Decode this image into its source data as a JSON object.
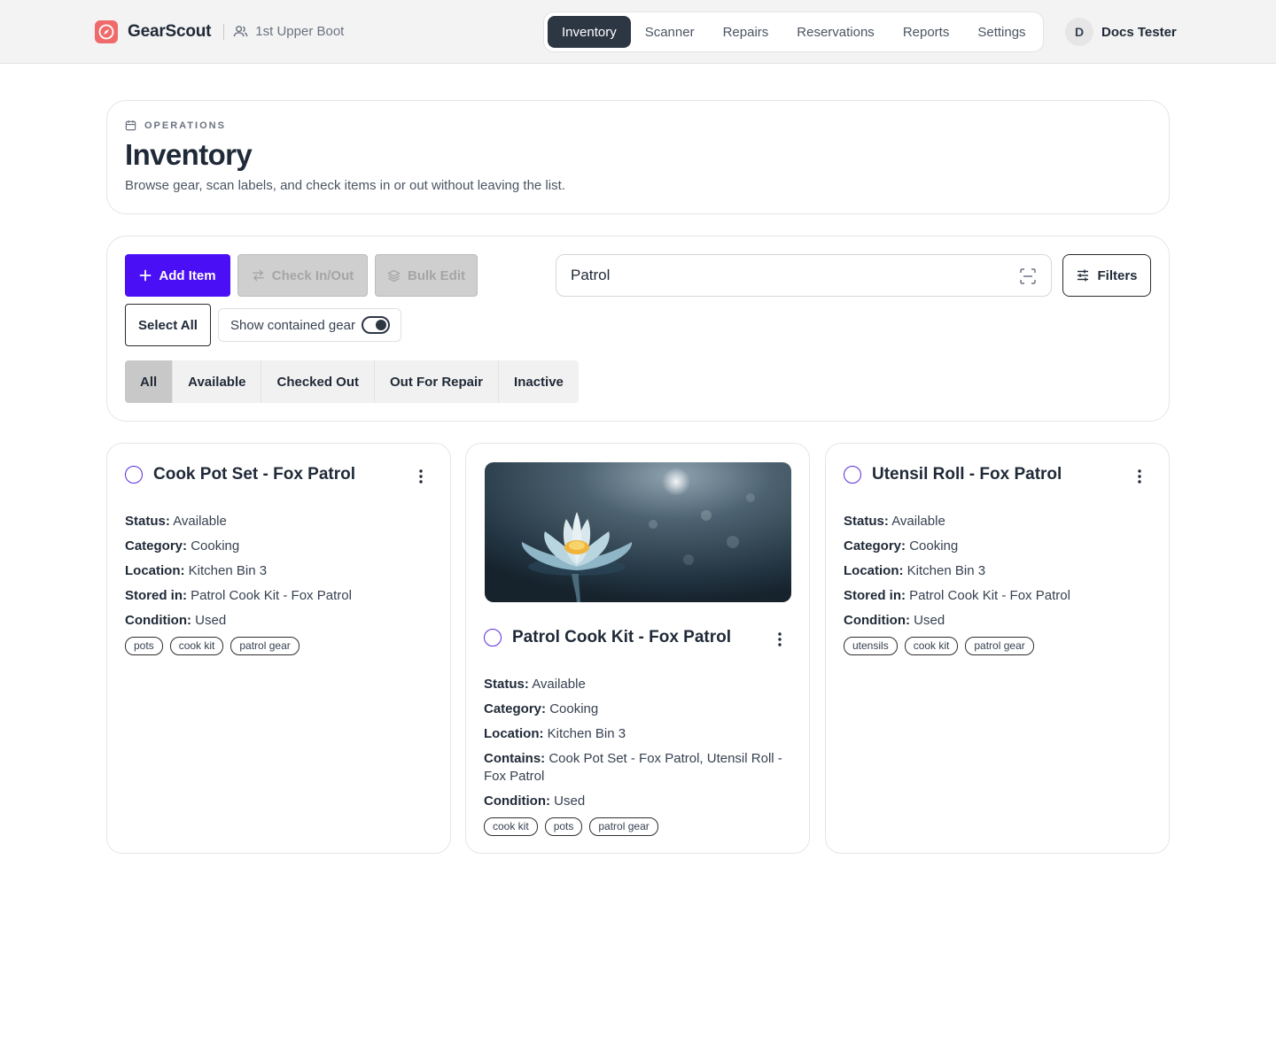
{
  "brand": {
    "name": "GearScout",
    "unit": "1st Upper Boot"
  },
  "nav": {
    "items": [
      {
        "label": "Inventory",
        "active": true
      },
      {
        "label": "Scanner"
      },
      {
        "label": "Repairs"
      },
      {
        "label": "Reservations"
      },
      {
        "label": "Reports"
      },
      {
        "label": "Settings"
      }
    ]
  },
  "user": {
    "initial": "D",
    "name": "Docs Tester"
  },
  "header": {
    "eyebrow": "OPERATIONS",
    "title": "Inventory",
    "subtitle": "Browse gear, scan labels, and check items in or out without leaving the list."
  },
  "toolbar": {
    "add_label": "Add Item",
    "check_label": "Check In/Out",
    "bulk_label": "Bulk Edit",
    "select_all_label": "Select All",
    "toggle_label": "Show contained gear",
    "toggle_on": true,
    "search_value": "Patrol",
    "filters_label": "Filters"
  },
  "status_tabs": [
    {
      "label": "All",
      "active": true
    },
    {
      "label": "Available"
    },
    {
      "label": "Checked Out"
    },
    {
      "label": "Out For Repair"
    },
    {
      "label": "Inactive"
    }
  ],
  "items": [
    {
      "title": "Cook Pot Set - Fox Patrol",
      "status": "Available",
      "category": "Cooking",
      "location": "Kitchen Bin 3",
      "stored_in": "Patrol Cook Kit - Fox Patrol",
      "condition": "Used",
      "tags": [
        "pots",
        "cook kit",
        "patrol gear"
      ]
    },
    {
      "title": "Patrol Cook Kit - Fox Patrol",
      "status": "Available",
      "category": "Cooking",
      "location": "Kitchen Bin 3",
      "contains": "Cook Pot Set - Fox Patrol, Utensil Roll - Fox Patrol",
      "condition": "Used",
      "tags": [
        "cook kit",
        "pots",
        "patrol gear"
      ],
      "image": "lotus-photo"
    },
    {
      "title": "Utensil Roll - Fox Patrol",
      "status": "Available",
      "category": "Cooking",
      "location": "Kitchen Bin 3",
      "stored_in": "Patrol Cook Kit - Fox Patrol",
      "condition": "Used",
      "tags": [
        "utensils",
        "cook kit",
        "patrol gear"
      ]
    }
  ],
  "labels": {
    "status": "Status:",
    "category": "Category:",
    "location": "Location:",
    "stored_in": "Stored in:",
    "contains": "Contains:",
    "condition": "Condition:"
  },
  "colors": {
    "primary": "#4a0ff5",
    "nav_active": "#2d3643",
    "brand_logo": "#ef6b6b"
  }
}
